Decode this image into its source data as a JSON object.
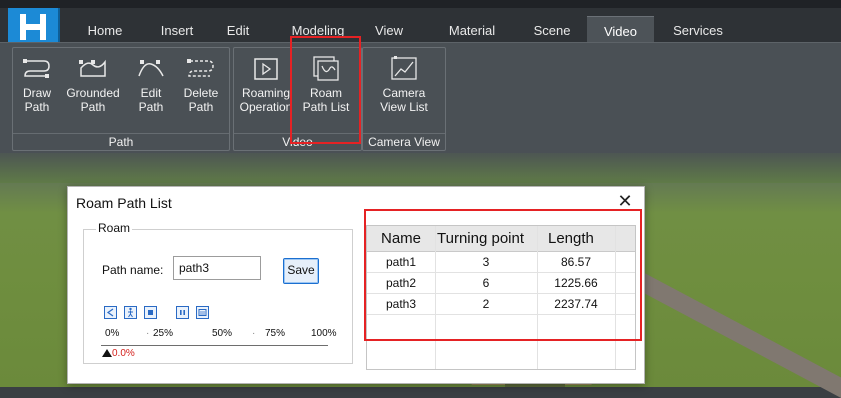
{
  "ribbon": {
    "tabs": [
      {
        "label": "Home"
      },
      {
        "label": "Insert"
      },
      {
        "label": "Edit"
      },
      {
        "label": "Modeling"
      },
      {
        "label": "View"
      },
      {
        "label": "Material"
      },
      {
        "label": "Scene"
      },
      {
        "label": "Video",
        "active": true
      },
      {
        "label": "Services"
      }
    ],
    "groups": {
      "path": {
        "label": "Path",
        "buttons": [
          {
            "line1": "Draw",
            "line2": "Path",
            "icon": "draw-path-icon"
          },
          {
            "line1": "Grounded",
            "line2": "Path",
            "icon": "grounded-path-icon"
          },
          {
            "line1": "Edit",
            "line2": "Path",
            "icon": "edit-path-icon"
          },
          {
            "line1": "Delete",
            "line2": "Path",
            "icon": "delete-path-icon"
          }
        ]
      },
      "video": {
        "label": "Video",
        "buttons": [
          {
            "line1": "Roaming",
            "line2": "Operation",
            "icon": "roaming-operation-icon"
          },
          {
            "line1": "Roam",
            "line2": "Path List",
            "icon": "roam-path-list-icon"
          }
        ]
      },
      "camera": {
        "label": "Camera View",
        "buttons": [
          {
            "line1": "Camera",
            "line2": "View List",
            "icon": "camera-view-list-icon"
          }
        ]
      }
    },
    "accent": "#1c8ad6"
  },
  "dialog": {
    "title": "Roam Path List",
    "close": "✕",
    "roam_group": {
      "legend": "Roam",
      "path_name_label": "Path name:",
      "path_name_value": "path3",
      "save_label": "Save",
      "controls": [
        "rewind-icon",
        "person-walk-icon",
        "stop-icon",
        "pause-icon",
        "settings-panel-icon"
      ],
      "ticks": [
        "0%",
        "25%",
        "50%",
        "75%",
        "100%"
      ],
      "progress_value": "0.0%"
    },
    "table": {
      "columns": [
        "Name",
        "Turning point",
        "Length"
      ],
      "rows": [
        [
          "path1",
          "3",
          "86.57"
        ],
        [
          "path2",
          "6",
          "1225.66"
        ],
        [
          "path3",
          "2",
          "2237.74"
        ]
      ]
    }
  },
  "colors": {
    "highlight": "#e52224",
    "progress_text": "#d4231f"
  }
}
